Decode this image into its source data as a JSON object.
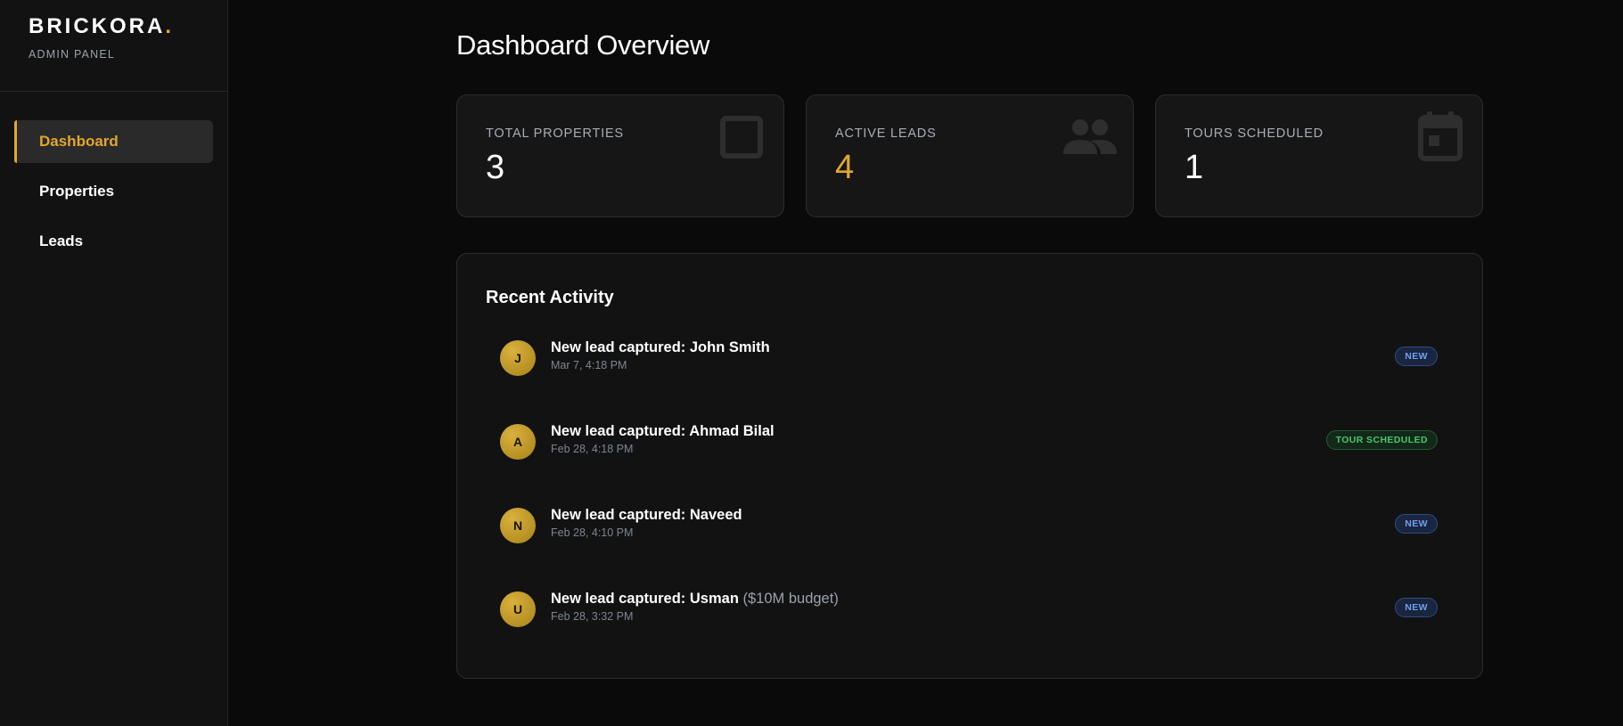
{
  "sidebar": {
    "brand": "BRICKORA",
    "brand_dot": ".",
    "subtitle": "ADMIN PANEL",
    "items": [
      {
        "label": "Dashboard",
        "active": true
      },
      {
        "label": "Properties",
        "active": false
      },
      {
        "label": "Leads",
        "active": false
      }
    ]
  },
  "main": {
    "title": "Dashboard Overview",
    "stats": [
      {
        "label": "TOTAL PROPERTIES",
        "value": "3",
        "icon": "square-icon"
      },
      {
        "label": "ACTIVE LEADS",
        "value": "4",
        "icon": "users-icon"
      },
      {
        "label": "TOURS SCHEDULED",
        "value": "1",
        "icon": "calendar-icon"
      }
    ],
    "activity": {
      "title": "Recent Activity",
      "items": [
        {
          "initial": "J",
          "prefix": "New lead captured: ",
          "name": "John Smith",
          "extra": "",
          "time": "Mar 7, 4:18 PM",
          "badge": "NEW"
        },
        {
          "initial": "A",
          "prefix": "New lead captured: ",
          "name": "Ahmad Bilal",
          "extra": "",
          "time": "Feb 28, 4:18 PM",
          "badge": "TOUR SCHEDULED"
        },
        {
          "initial": "N",
          "prefix": "New lead captured: ",
          "name": "Naveed",
          "extra": "",
          "time": "Feb 28, 4:10 PM",
          "badge": "NEW"
        },
        {
          "initial": "U",
          "prefix": "New lead captured: ",
          "name": "Usman",
          "extra": "($10M budget)",
          "time": "Feb 28, 3:32 PM",
          "badge": "NEW"
        }
      ]
    }
  },
  "colors": {
    "accent": "#e2a72e",
    "badge_new": "#6f9ff0",
    "badge_tour": "#4cc46e"
  }
}
